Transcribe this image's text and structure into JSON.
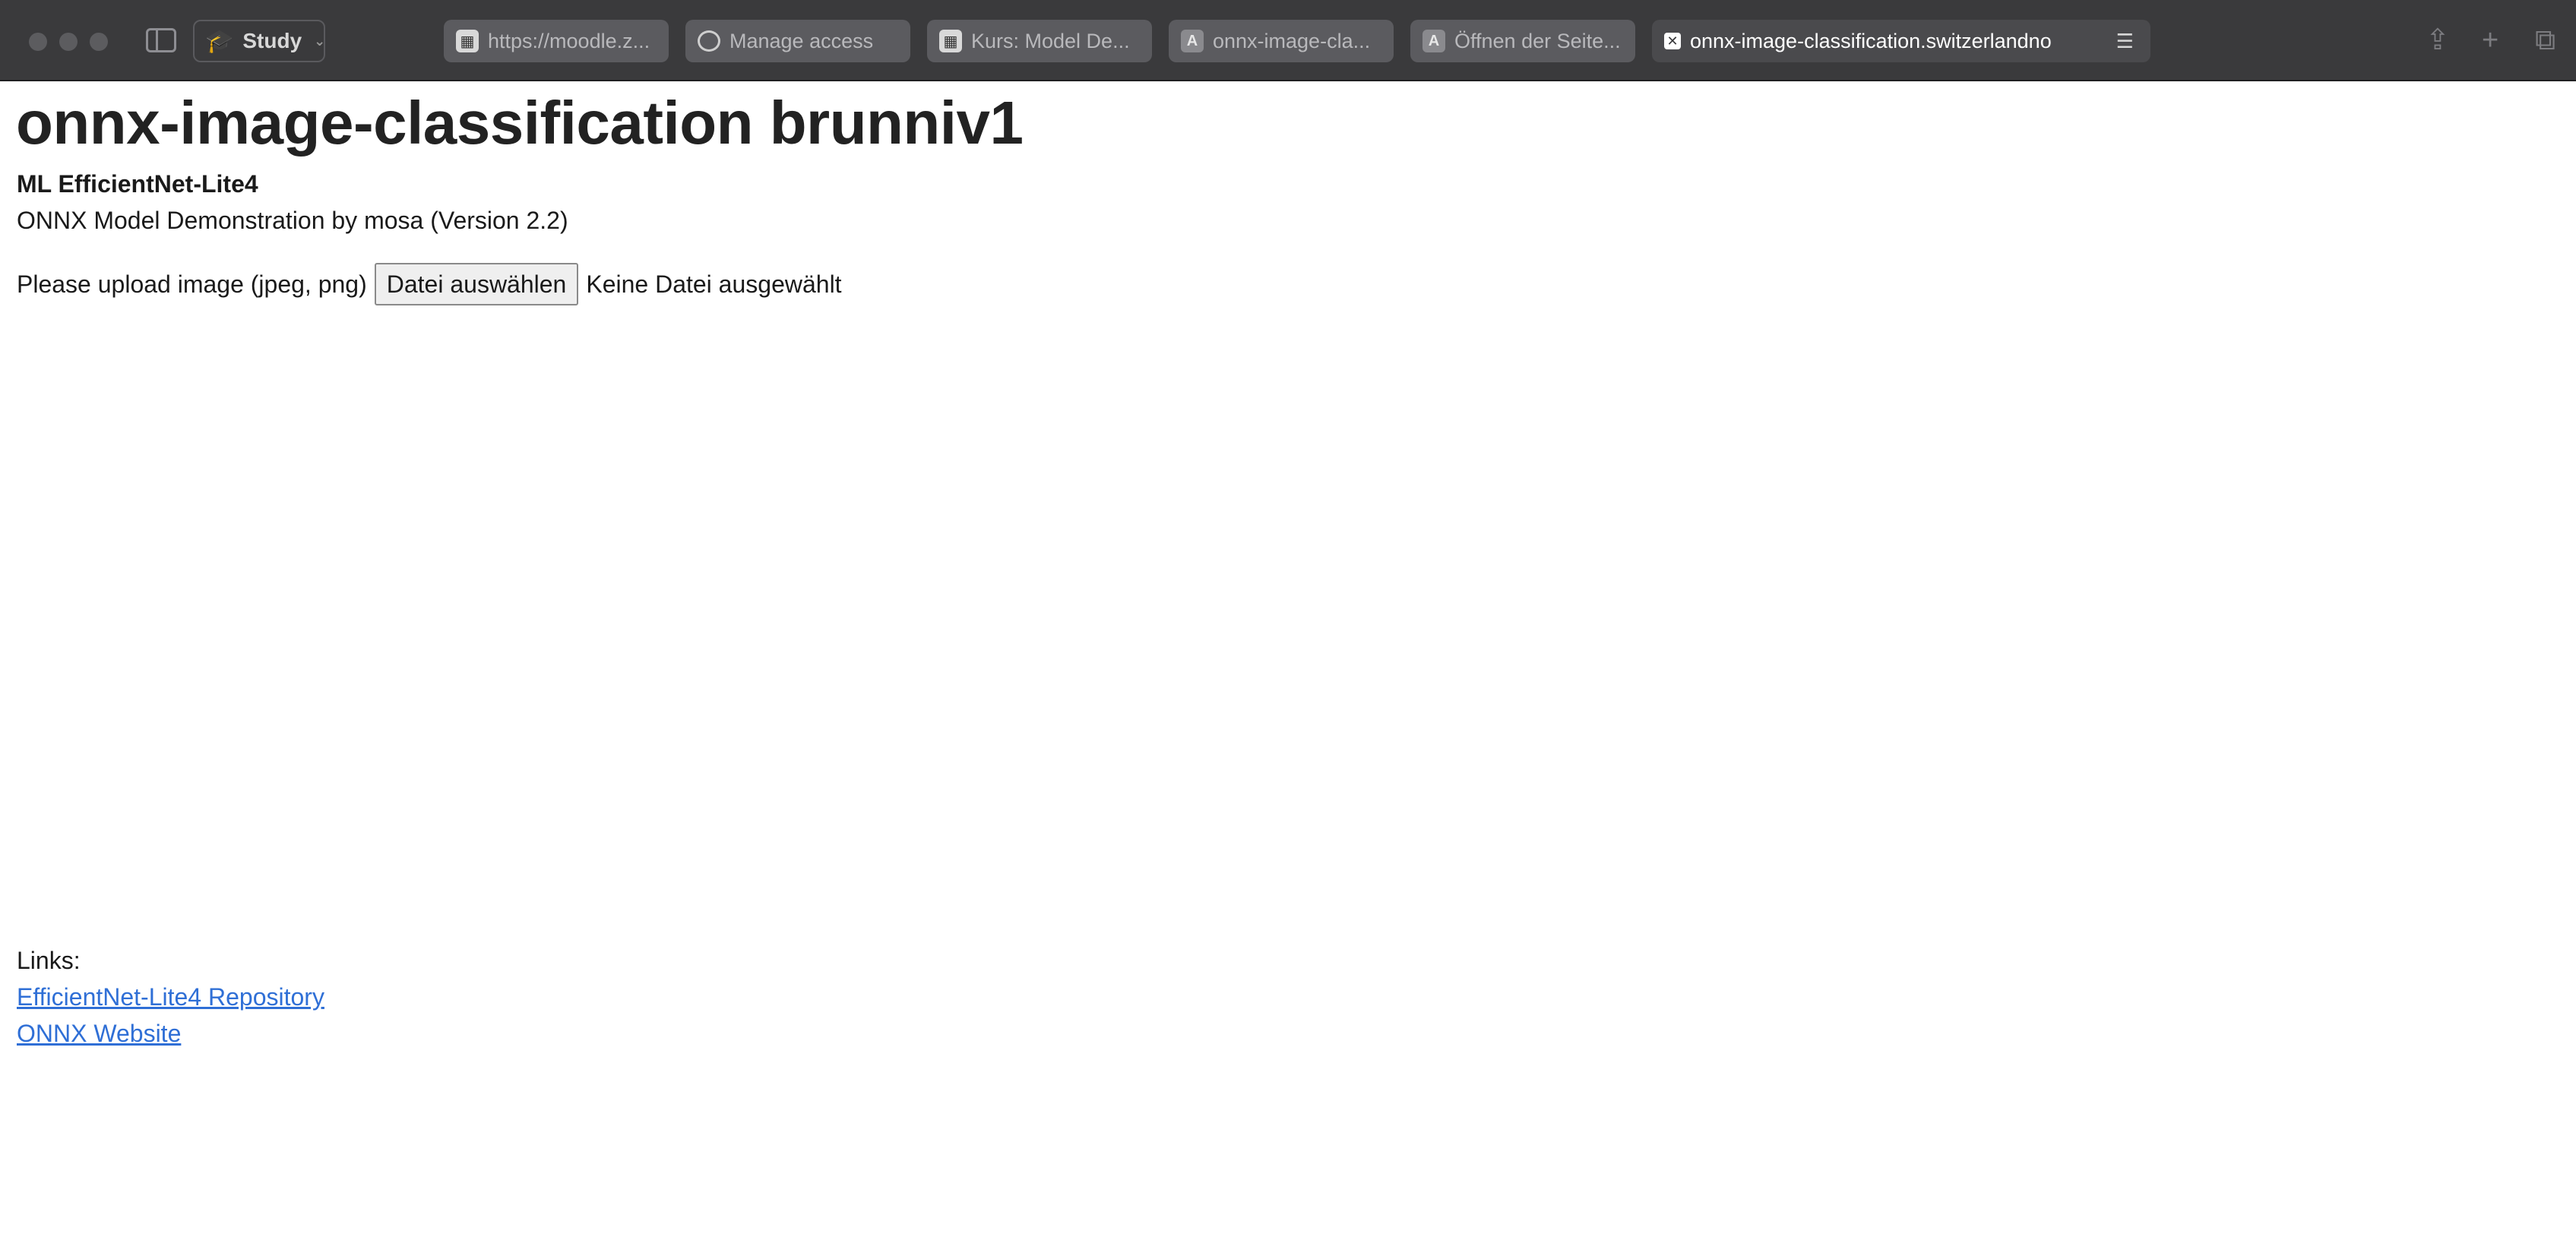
{
  "browser": {
    "tab_group": "Study",
    "tabs": [
      {
        "title": "https://moodle.z...",
        "favicon": "moodle-icon"
      },
      {
        "title": "Manage access",
        "favicon": "github-icon"
      },
      {
        "title": "Kurs: Model De...",
        "favicon": "moodle-icon"
      },
      {
        "title": "onnx-image-cla...",
        "favicon": "letter-a-icon",
        "letter": "A"
      },
      {
        "title": "Öffnen der Seite...",
        "favicon": "letter-a-icon",
        "letter": "A"
      },
      {
        "title": "onnx-image-classification.switzerlandno",
        "favicon": "close-icon",
        "active": true
      }
    ]
  },
  "page": {
    "title": "onnx-image-classification brunniv1",
    "subtitle": "ML EfficientNet-Lite4",
    "description": "ONNX Model Demonstration by mosa (Version 2.2)",
    "upload": {
      "label": "Please upload image (jpeg, png)",
      "button": "Datei auswählen",
      "status": "Keine Datei ausgewählt"
    },
    "links": {
      "label": "Links:",
      "items": [
        {
          "text": "EfficientNet-Lite4 Repository"
        },
        {
          "text": "ONNX Website"
        }
      ]
    }
  },
  "colors": {
    "toolbar": "#3a3a3c",
    "link": "#2f6fd6",
    "heading": "#222222"
  }
}
